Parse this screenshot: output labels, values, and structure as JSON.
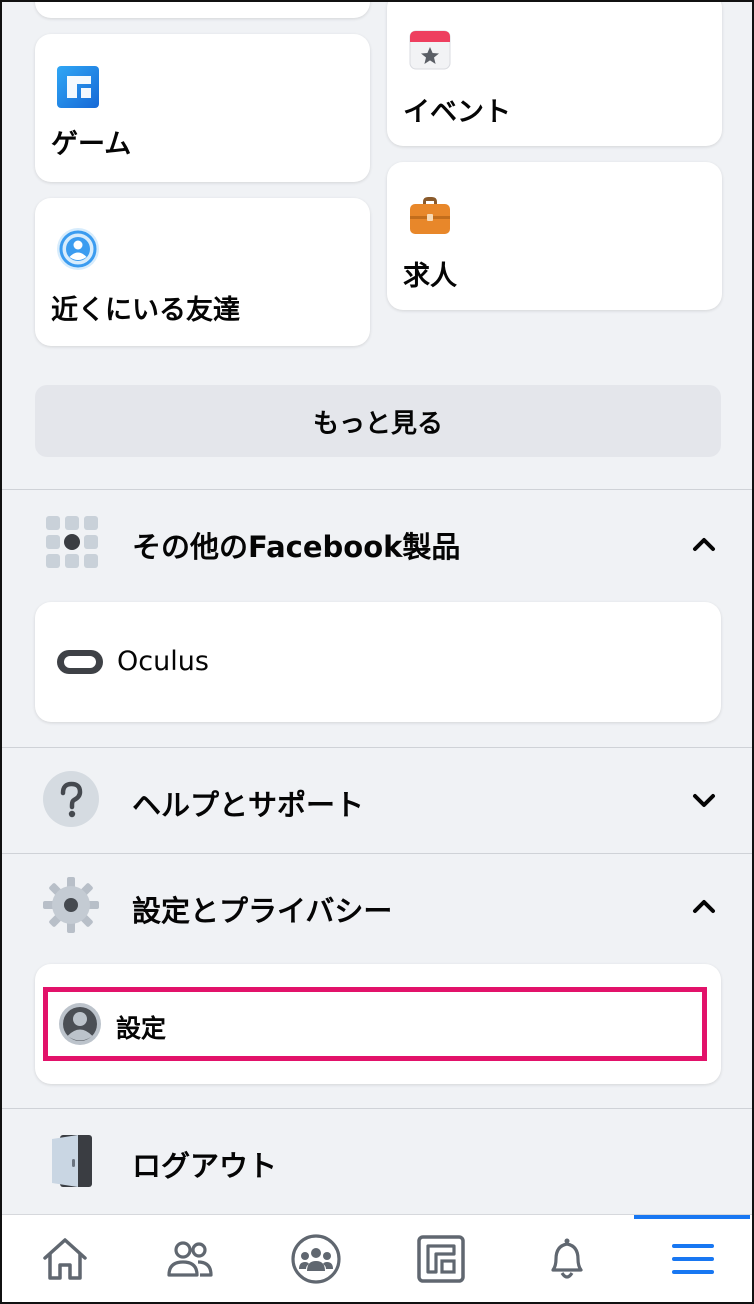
{
  "shortcuts": {
    "game": "ゲーム",
    "event": "イベント",
    "nearby": "近くにいる友達",
    "jobs": "求人"
  },
  "see_more": "もっと見る",
  "sections": {
    "other_products": {
      "title": "その他のFacebook製品",
      "items": [
        "Oculus"
      ]
    },
    "help": {
      "title": "ヘルプとサポート"
    },
    "settings_privacy": {
      "title": "設定とプライバシー",
      "items": [
        "設定"
      ]
    },
    "logout": "ログアウト"
  },
  "icons": {
    "game": "game-icon",
    "event": "calendar-icon",
    "nearby": "nearby-friends-icon",
    "jobs": "briefcase-icon",
    "products": "apps-grid-icon",
    "oculus": "oculus-headset-icon",
    "help": "question-mark-icon",
    "settings": "gear-icon",
    "profile": "profile-avatar-icon",
    "logout": "door-icon"
  },
  "bottom_nav": [
    "home",
    "friends",
    "groups",
    "gaming",
    "notifications",
    "menu"
  ],
  "colors": {
    "accent": "#1877f2",
    "highlight_box": "#e2126a",
    "background": "#f0f2f5"
  }
}
